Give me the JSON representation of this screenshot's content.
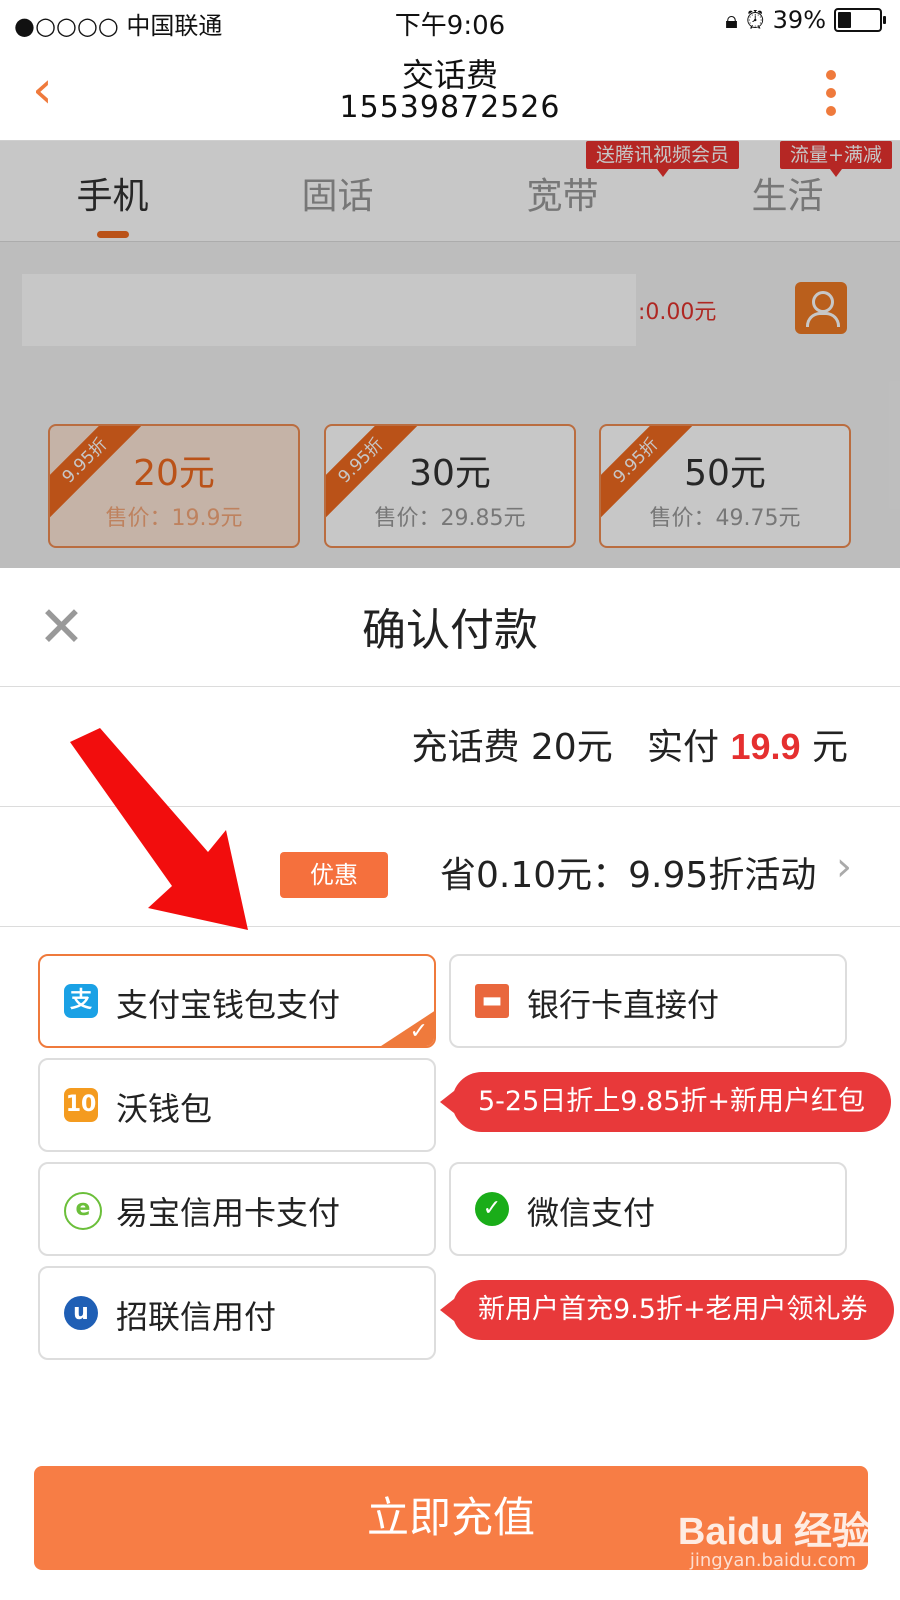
{
  "status_bar": {
    "carrier": "●○○○○ 中国联通",
    "time": "下午9:06",
    "battery": "39%",
    "battery_level": 0.39
  },
  "header": {
    "title": "交话费",
    "subtitle": "15539872526"
  },
  "tabs": [
    {
      "label": "手机",
      "active": true,
      "badge": ""
    },
    {
      "label": "固话",
      "active": false,
      "badge": ""
    },
    {
      "label": "宽带",
      "active": false,
      "badge": "送腾讯视频会员"
    },
    {
      "label": "生活",
      "active": false,
      "badge": "流量+满减"
    }
  ],
  "phone_row": {
    "balance_text": ":0.00元"
  },
  "denominations": [
    {
      "amount": "20元",
      "price": "售价：19.9元",
      "ribbon": "9.95折",
      "selected": true
    },
    {
      "amount": "30元",
      "price": "售价：29.85元",
      "ribbon": "9.95折",
      "selected": false
    },
    {
      "amount": "50元",
      "price": "售价：49.75元",
      "ribbon": "9.95折",
      "selected": false
    }
  ],
  "sheet": {
    "title": "确认付款",
    "summary_prefix": "充话费 20元   实付 ",
    "paid_amount": "19.9",
    "summary_suffix": " 元",
    "discount_badge": "优惠",
    "discount_text": "省0.10元：9.95折活动"
  },
  "payment_options": [
    {
      "label": "支付宝钱包支付",
      "icon": "alipay-icon",
      "selected": true
    },
    {
      "label": "银行卡直接付",
      "icon": "bank-card-icon",
      "selected": false
    },
    {
      "label": "沃钱包",
      "icon": "wo-wallet-icon",
      "selected": false
    },
    {
      "label": "易宝信用卡支付",
      "icon": "yeepay-icon",
      "selected": false
    },
    {
      "label": "微信支付",
      "icon": "wechat-pay-icon",
      "selected": false
    },
    {
      "label": "招联信用付",
      "icon": "zhaolian-icon",
      "selected": false
    }
  ],
  "promos": [
    "5-25日折上9.85折+新用户红包",
    "新用户首充9.5折+老用户领礼券"
  ],
  "cta_label": "立即充值",
  "watermark": {
    "text": "Baidu 经验",
    "sub": "jingyan.baidu.com"
  },
  "colors": {
    "accent": "#ef7a3c",
    "price_red": "#e52f2f",
    "promo_red": "#e8393a",
    "cta": "#f77d45"
  }
}
